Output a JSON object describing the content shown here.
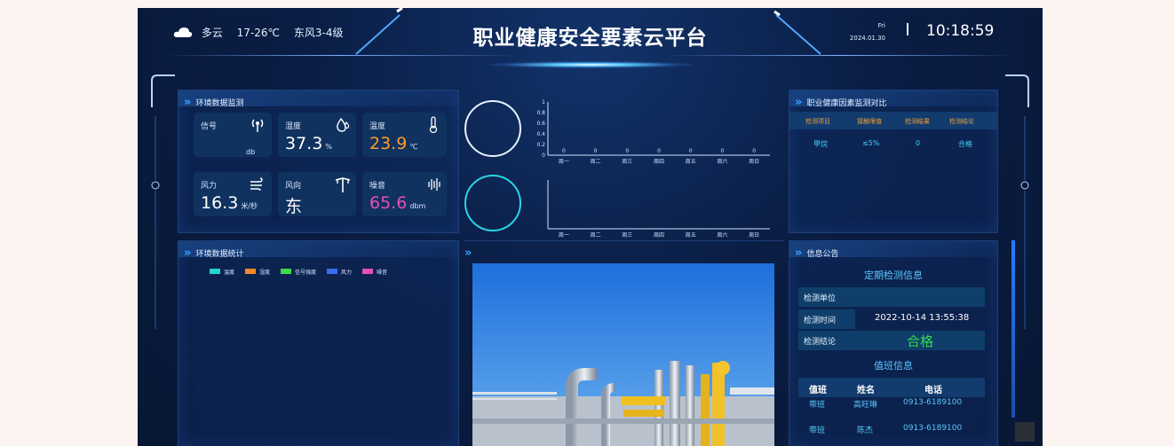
{
  "weather": {
    "icon": "cloud-icon",
    "condition": "多云",
    "temperature": "17-26℃",
    "wind": "东风3-4级"
  },
  "header": {
    "title": "职业健康安全要素云平台",
    "weekday": "Fri",
    "date": "2024.01.30",
    "time": "10:18:59"
  },
  "env_monitor": {
    "title": "环境数据监测",
    "tiles": [
      {
        "label": "信号",
        "value": "",
        "unit": "db",
        "icon": "signal-icon"
      },
      {
        "label": "湿度",
        "value": "37.3",
        "unit": "%",
        "icon": "humidity-icon"
      },
      {
        "label": "温度",
        "value": "23.9",
        "unit": "℃",
        "icon": "thermometer-icon"
      },
      {
        "label": "风力",
        "value": "16.3",
        "unit": "米/秒",
        "icon": "wind-icon"
      },
      {
        "label": "风向",
        "value": "东",
        "unit": "",
        "icon": "wind-vane-icon"
      },
      {
        "label": "噪音",
        "value": "65.6",
        "unit": "dbm",
        "icon": "noise-icon"
      }
    ],
    "colors": {
      "temperature": "#ff9a2e",
      "noise": "#e64fb4"
    }
  },
  "chart_data": [
    {
      "type": "bar",
      "categories": [
        "周一",
        "周二",
        "周三",
        "周四",
        "周五",
        "周六",
        "周日"
      ],
      "values": [
        0,
        0,
        0,
        0,
        0,
        0,
        0
      ],
      "yticks": [
        "0",
        "0.2",
        "0.4",
        "0.6",
        "0.8",
        "1"
      ],
      "ylim": [
        0,
        1
      ]
    },
    {
      "type": "bar",
      "categories": [
        "周一",
        "周二",
        "周三",
        "周四",
        "周五",
        "周六",
        "周日"
      ],
      "values": []
    }
  ],
  "env_stats": {
    "title": "环境数据统计",
    "legend": [
      {
        "name": "温度",
        "color": "#27d3d0"
      },
      {
        "name": "湿度",
        "color": "#f08a24"
      },
      {
        "name": "信号强度",
        "color": "#3ddc4a"
      },
      {
        "name": "风力",
        "color": "#3a6cf0"
      },
      {
        "name": "噪音",
        "color": "#e64fb4"
      }
    ]
  },
  "health_compare": {
    "title": "职业健康因素监测对比",
    "headers": [
      "检测项目",
      "接触限值",
      "检测结果",
      "检测结论"
    ],
    "rows": [
      [
        "甲烷",
        "≤5%",
        "0",
        "合格"
      ]
    ]
  },
  "notice": {
    "title": "信息公告",
    "inspection_title": "定期检测信息",
    "rows": [
      {
        "label": "检测单位",
        "value": ""
      },
      {
        "label": "检测时间",
        "value": "2022-10-14 13:55:38"
      },
      {
        "label": "检测结论",
        "value": "合格"
      }
    ],
    "pass_color": "#2fdc4f",
    "duty_title": "值班信息",
    "duty_headers": [
      "值班",
      "姓名",
      "电话"
    ],
    "duty_rows": [
      [
        "带班",
        "高旺琳",
        "0913-6189100"
      ],
      [
        "带班",
        "陈杰",
        "0913-6189100"
      ]
    ]
  }
}
